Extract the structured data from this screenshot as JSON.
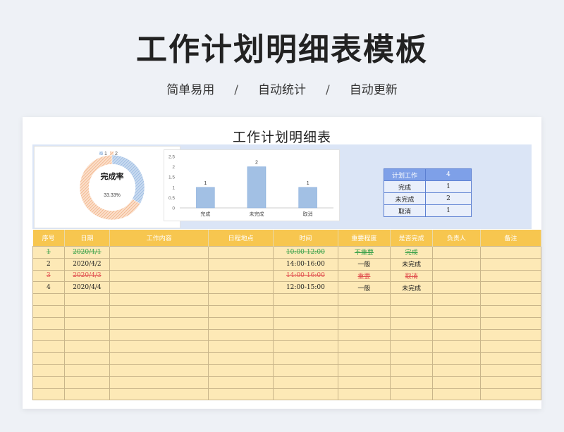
{
  "header": {
    "title": "工作计划明细表模板",
    "tags": [
      "简单易用",
      "自动统计",
      "自动更新"
    ],
    "separator": "/"
  },
  "sheet": {
    "title": "工作计划明细表",
    "donut": {
      "legend": [
        "1",
        "2"
      ],
      "label": "完成率",
      "percent": "33.33%",
      "completion_fraction": 0.3333,
      "colors": [
        "#8fb2de",
        "#f0a97a"
      ]
    },
    "stats": {
      "rows": [
        {
          "label": "计划工作",
          "value": "4"
        },
        {
          "label": "完成",
          "value": "1"
        },
        {
          "label": "未完成",
          "value": "2"
        },
        {
          "label": "取消",
          "value": "1"
        }
      ]
    },
    "table": {
      "headers": [
        "序号",
        "日期",
        "工作内容",
        "日程地点",
        "时间",
        "重要程度",
        "是否完成",
        "负责人",
        "备注"
      ],
      "rows": [
        {
          "cells": [
            "1",
            "2020/4/1",
            "",
            "",
            "10:00-12:00",
            "不重要",
            "完成",
            "",
            ""
          ],
          "style": "strike-g"
        },
        {
          "cells": [
            "2",
            "2020/4/2",
            "",
            "",
            "14:00-16:00",
            "一般",
            "未完成",
            "",
            ""
          ],
          "style": ""
        },
        {
          "cells": [
            "3",
            "2020/4/3",
            "",
            "",
            "14:00-16:00",
            "重要",
            "取消",
            "",
            ""
          ],
          "style": "strike-r"
        },
        {
          "cells": [
            "4",
            "2020/4/4",
            "",
            "",
            "12:00-15:00",
            "一般",
            "未完成",
            "",
            ""
          ],
          "style": ""
        }
      ],
      "empty_rows": 9
    }
  },
  "chart_data": {
    "type": "bar",
    "categories": [
      "完成",
      "未完成",
      "取消"
    ],
    "values": [
      1,
      2,
      1
    ],
    "data_labels": [
      "1",
      "2",
      "1"
    ],
    "ylim": [
      0,
      2.5
    ],
    "yticks": [
      "0",
      "0.5",
      "1",
      "1.5",
      "2",
      "2.5"
    ],
    "bar_color": "#8fb2de",
    "title": "",
    "xlabel": "",
    "ylabel": ""
  }
}
